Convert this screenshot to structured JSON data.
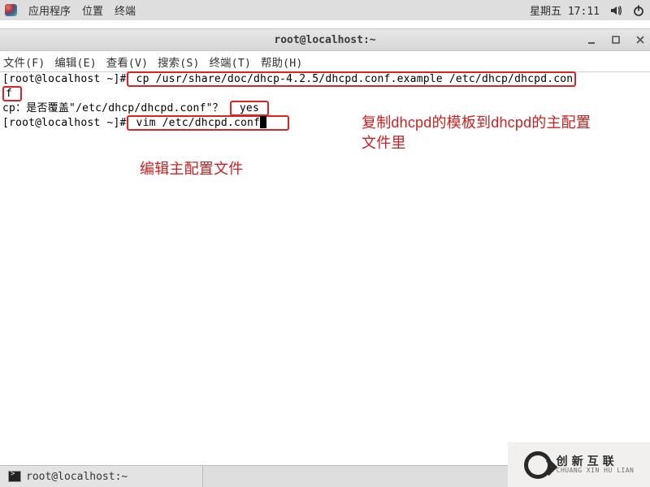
{
  "panel": {
    "apps": "应用程序",
    "places": "位置",
    "terminal": "终端",
    "clock": "星期五 17:11"
  },
  "window": {
    "title": "root@localhost:~"
  },
  "menu": {
    "file": "文件(F)",
    "edit": "编辑(E)",
    "view": "查看(V)",
    "search": "搜索(S)",
    "terminal": "终端(T)",
    "help": "帮助(H)"
  },
  "term": {
    "prompt1_user": "[root@localhost ~]#",
    "cmd_cp_a": " cp /usr/share/doc/dhcp-4.2.5/dhcpd.conf.example /etc/dhcp/dhcpd.con",
    "cmd_cp_b": "f ",
    "overwrite_prompt": "cp：是否覆盖\"/etc/dhcp/dhcpd.conf\"？ ",
    "overwrite_ans": " yes ",
    "prompt2_user": "[root@localhost ~]#",
    "cmd_vim": " vim /etc/dhcpd.conf"
  },
  "annot": {
    "right1": "复制dhcpd的模板到dhcpd的主配置",
    "right2": "文件里",
    "left": "编辑主配置文件"
  },
  "taskbar": {
    "item": "root@localhost:~"
  },
  "watermark": {
    "cn": "创新互联",
    "en": "CHUANG XIN HU LIAN"
  }
}
